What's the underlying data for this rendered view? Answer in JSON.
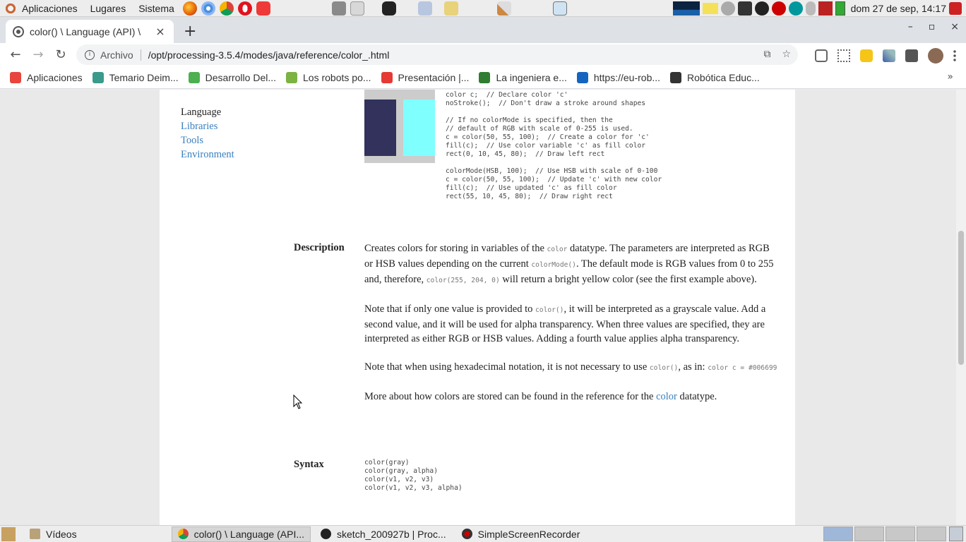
{
  "system_bar": {
    "menus": [
      "Aplicaciones",
      "Lugares",
      "Sistema"
    ],
    "clock": "dom 27 de sep, 14:17"
  },
  "browser": {
    "tab_title": "color() \\ Language (API) \\",
    "close_tab": "×",
    "new_tab": "+",
    "window_controls": {
      "minimize": "–",
      "maximize": "▫",
      "close": "×"
    },
    "address": {
      "label": "Archivo",
      "url": "/opt/processing-3.5.4/modes/java/reference/color_.html"
    },
    "bookmarks": [
      {
        "label": "Aplicaciones",
        "icon": "apps-grid-icon",
        "color": "#e8453c"
      },
      {
        "label": "Temario Deim...",
        "icon": "temario-icon",
        "color": "#3a9a8c"
      },
      {
        "label": "Desarrollo Del...",
        "icon": "desarrollo-icon",
        "color": "#4caf50"
      },
      {
        "label": "Los robots po...",
        "icon": "robots-icon",
        "color": "#7cb342"
      },
      {
        "label": "Presentación |...",
        "icon": "presentacion-icon",
        "color": "#e53935"
      },
      {
        "label": "La ingeniera e...",
        "icon": "ingeniera-icon",
        "color": "#2e7d32"
      },
      {
        "label": "https://eu-rob...",
        "icon": "eu-rob-icon",
        "color": "#1565c0"
      },
      {
        "label": "Robótica Educ...",
        "icon": "robotica-icon",
        "color": "#333333"
      }
    ],
    "bookmarks_more": "»"
  },
  "page": {
    "sidenav": {
      "current": "Language",
      "links": [
        "Libraries",
        "Tools",
        "Environment"
      ]
    },
    "example_code": "color c;  // Declare color 'c'\nnoStroke();  // Don't draw a stroke around shapes\n\n// If no colorMode is specified, then the\n// default of RGB with scale of 0-255 is used.\nc = color(50, 55, 100);  // Create a color for 'c'\nfill(c);  // Use color variable 'c' as fill color\nrect(0, 10, 45, 80);  // Draw left rect\n\ncolorMode(HSB, 100);  // Use HSB with scale of 0-100\nc = color(50, 55, 100);  // Update 'c' with new color\nfill(c);  // Use updated 'c' as fill color\nrect(55, 10, 45, 80);  // Draw right rect",
    "example_colors": {
      "left": "#32325d",
      "right": "#80ffff"
    },
    "description_label": "Description",
    "desc": {
      "p1a": "Creates colors for storing in variables of the ",
      "p1k1": "color",
      "p1b": " datatype. The parameters are interpreted as RGB or HSB values depending on the current ",
      "p1k2": "colorMode()",
      "p1c": ". The default mode is RGB values from 0 to 255 and, therefore, ",
      "p1k3": "color(255, 204, 0)",
      "p1d": " will return a bright yellow color (see the first example above).",
      "p2a": "Note that if only one value is provided to ",
      "p2k1": "color()",
      "p2b": ", it will be interpreted as a grayscale value. Add a second value, and it will be used for alpha transparency. When three values are specified, they are interpreted as either RGB or HSB values. Adding a fourth value applies alpha transparency.",
      "p3a": "Note that when using hexadecimal notation, it is not necessary to use ",
      "p3k1": "color()",
      "p3b": ", as in: ",
      "p3k2": "color c = #006699",
      "p4a": "More about how colors are stored can be found in the reference for the ",
      "p4link": "color",
      "p4b": " datatype."
    },
    "syntax_label": "Syntax",
    "syntax_code": "color(gray)\ncolor(gray, alpha)\ncolor(v1, v2, v3)\ncolor(v1, v2, v3, alpha)"
  },
  "taskbar": {
    "items": [
      {
        "label": "Vídeos",
        "active": false
      },
      {
        "label": "color() \\ Language (API...",
        "active": true
      },
      {
        "label": "sketch_200927b | Proc...",
        "active": false
      },
      {
        "label": "SimpleScreenRecorder",
        "active": false
      }
    ]
  }
}
